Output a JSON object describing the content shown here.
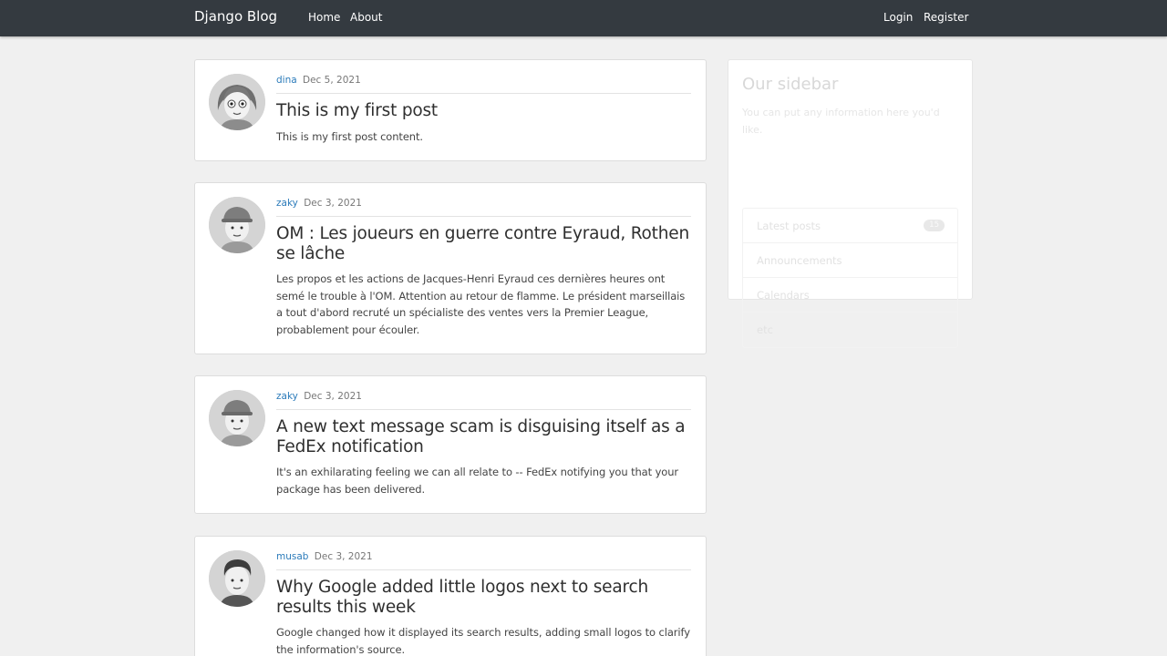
{
  "navbar": {
    "brand": "Django Blog",
    "links": [
      "Home",
      "About"
    ],
    "auth_links": [
      "Login",
      "Register"
    ]
  },
  "posts": [
    {
      "author": "dina",
      "date": "Dec 5, 2021",
      "title": "This is my first post",
      "content": "This is my first post content.",
      "avatar_icon": "female-user-avatar-icon"
    },
    {
      "author": "zaky",
      "date": "Dec 3, 2021",
      "title": "OM : Les joueurs en guerre contre Eyraud, Rothen se lâche",
      "content": "Les propos et les actions de Jacques-Henri Eyraud ces dernières heures ont semé le trouble à l'OM. Attention au retour de flamme. Le président marseillais a tout d'abord recruté un spécialiste des ventes vers la Premier League, probablement pour écouler.",
      "avatar_icon": "male-user-cap-avatar-icon"
    },
    {
      "author": "zaky",
      "date": "Dec 3, 2021",
      "title": "A new text message scam is disguising itself as a FedEx notification",
      "content": "It's an exhilarating feeling we can all relate to -- FedEx notifying you that your package has been delivered.",
      "avatar_icon": "male-user-cap-avatar-icon"
    },
    {
      "author": "musab",
      "date": "Dec 3, 2021",
      "title": "Why Google added little logos next to search results this week",
      "content": "Google changed how it displayed its search results, adding small logos to clarify the information's source.",
      "avatar_icon": "male-user-avatar-icon"
    }
  ],
  "sidebar": {
    "title": "Our sidebar",
    "text": "You can put any information here you'd like.",
    "items": [
      {
        "label": "Latest posts",
        "badge": "15"
      },
      {
        "label": "Announcements"
      },
      {
        "label": "Calendars"
      },
      {
        "label": "etc"
      }
    ]
  },
  "colors": {
    "navbar_bg": "#343a40",
    "page_bg": "#f0f0f0",
    "author_link": "#2b7bba"
  }
}
